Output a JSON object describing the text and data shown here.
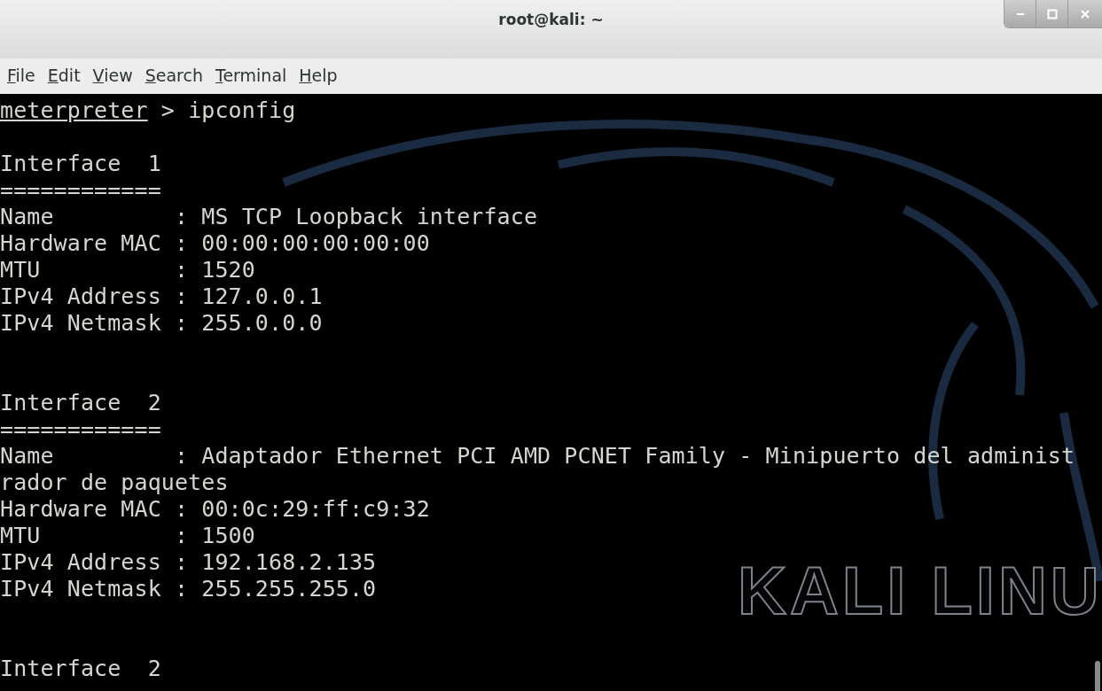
{
  "window": {
    "title": "root@kali: ~"
  },
  "menu": [
    "File",
    "Edit",
    "View",
    "Search",
    "Terminal",
    "Help"
  ],
  "terminal": {
    "prompt": {
      "name": "meterpreter",
      "command": " > ipconfig"
    },
    "blocks": [
      [
        "Interface  1",
        "============",
        "Name         : MS TCP Loopback interface",
        "Hardware MAC : 00:00:00:00:00:00",
        "MTU          : 1520",
        "IPv4 Address : 127.0.0.1",
        "IPv4 Netmask : 255.0.0.0"
      ],
      [
        "Interface  2",
        "============",
        "Name         : Adaptador Ethernet PCI AMD PCNET Family - Minipuerto del administ",
        "rador de paquetes",
        "Hardware MAC : 00:0c:29:ff:c9:32",
        "MTU          : 1500",
        "IPv4 Address : 192.168.2.135",
        "IPv4 Netmask : 255.255.255.0"
      ],
      [
        "Interface  2"
      ]
    ],
    "background_logo": "KALI LINU"
  }
}
